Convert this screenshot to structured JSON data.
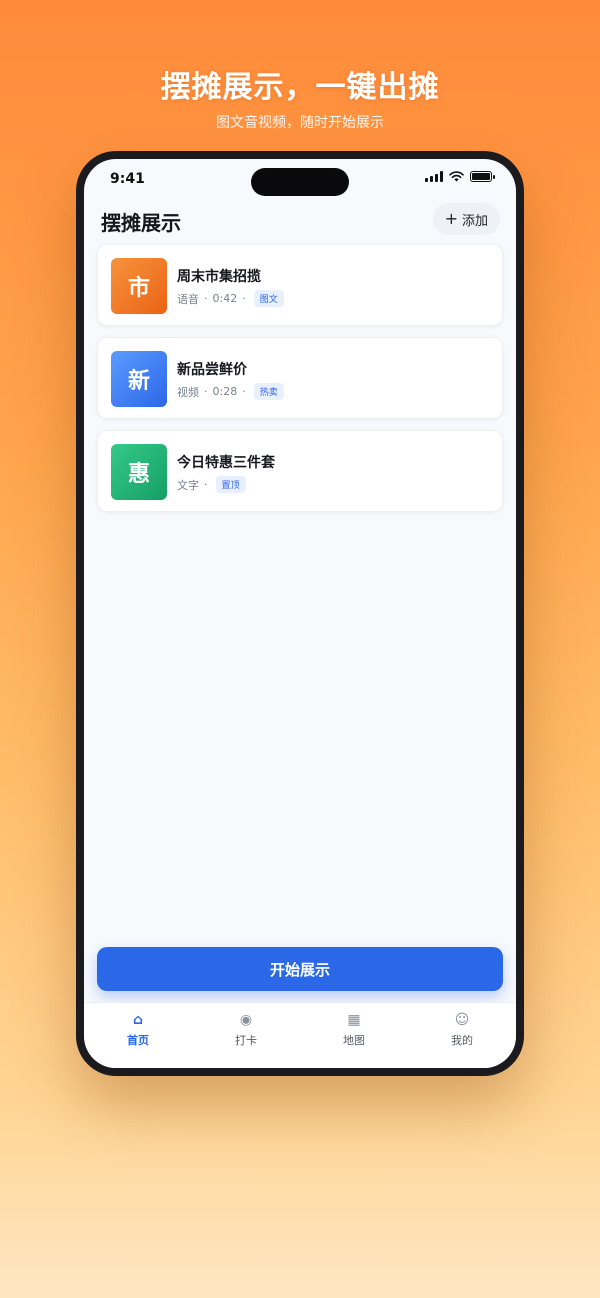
{
  "hero": {
    "title": "摆摊展示，一键出摊",
    "subtitle": "图文音视频，随时开始展示"
  },
  "status_bar": {
    "time": "9:41"
  },
  "header": {
    "title": "摆摊展示",
    "add_label": "添加",
    "add_icon": "plus-icon"
  },
  "items": [
    {
      "thumb_char": "市",
      "title": "周末市集招揽",
      "type": "语音",
      "duration": "0:42",
      "tag": "图文",
      "color": "#f07a25"
    },
    {
      "thumb_char": "新",
      "title": "新品尝鲜价",
      "type": "视频",
      "duration": "0:28",
      "tag": "热卖",
      "color": "#3a78f0"
    },
    {
      "thumb_char": "惠",
      "title": "今日特惠三件套",
      "type": "文字",
      "duration": "",
      "tag": "置顶",
      "color": "#20b574"
    }
  ],
  "start_button": {
    "label": "开始展示"
  },
  "tabs": [
    {
      "label": "首页",
      "icon": "home-icon",
      "active": true
    },
    {
      "label": "打卡",
      "icon": "target-icon",
      "active": false
    },
    {
      "label": "地图",
      "icon": "grid-icon",
      "active": false
    },
    {
      "label": "我的",
      "icon": "smile-icon",
      "active": false
    }
  ],
  "colors": {
    "accent": "#2a68e8",
    "tag_text": "#2f66e0"
  }
}
